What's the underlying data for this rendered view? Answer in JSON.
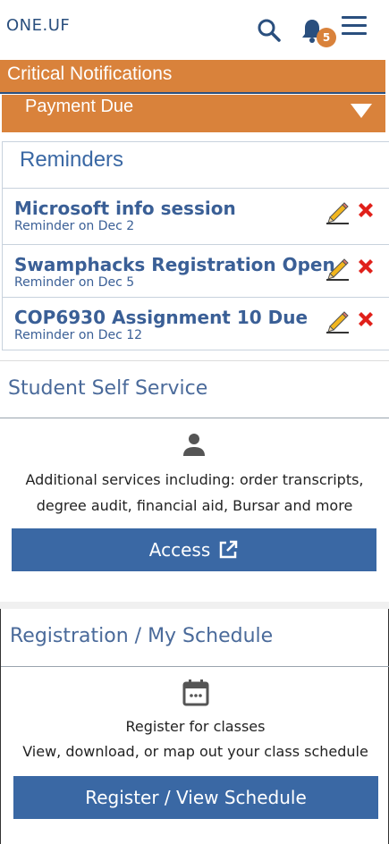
{
  "header": {
    "brand": "ONE.UF",
    "notification_count": "5"
  },
  "critical": {
    "title": "Critical Notifications",
    "item": "Payment Due"
  },
  "reminders": {
    "title": "Reminders",
    "items": [
      {
        "name": "Microsoft info session",
        "date": "Reminder on Dec 2"
      },
      {
        "name": "Swamphacks Registration Open",
        "date": "Reminder on Dec 5"
      },
      {
        "name": "COP6930 Assignment 10 Due",
        "date": "Reminder on Dec 12"
      }
    ]
  },
  "self_service": {
    "title": "Student Self Service",
    "desc_line1": "Additional services including: order transcripts,",
    "desc_line2": "degree audit, financial aid, Bursar and more",
    "button": "Access"
  },
  "registration": {
    "title": "Registration / My Schedule",
    "desc_line1": "Register for classes",
    "desc_line2": "View, download, or map out your class schedule",
    "button": "Register / View Schedule"
  },
  "colors": {
    "brand_blue": "#3a68a4",
    "accent_orange": "#d9823b",
    "delete_red": "#e0201a"
  }
}
